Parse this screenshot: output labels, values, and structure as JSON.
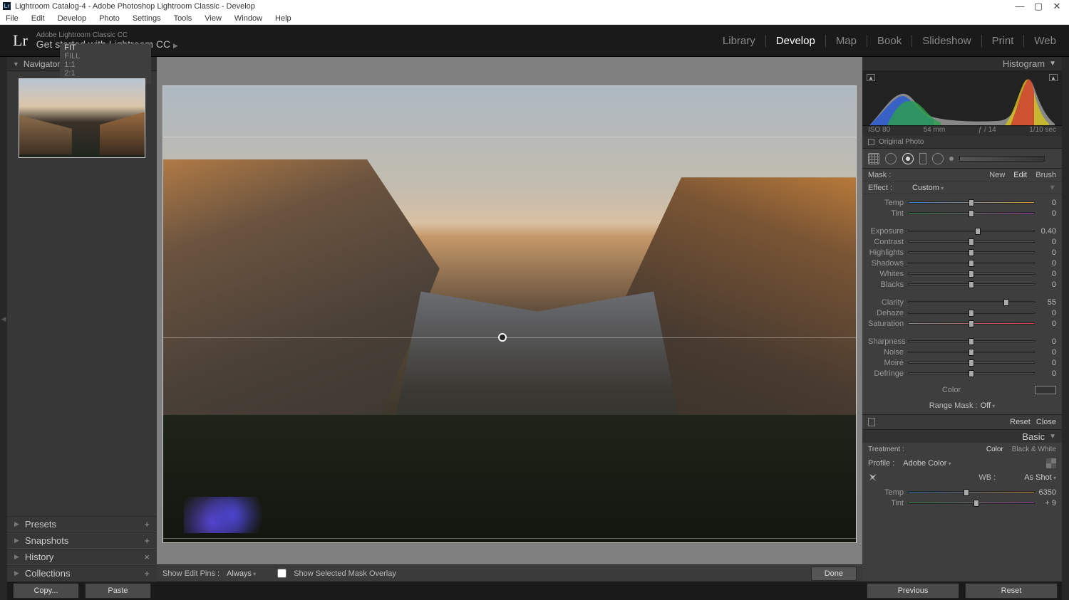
{
  "window": {
    "title": "Lightroom Catalog-4 - Adobe Photoshop Lightroom Classic - Develop"
  },
  "menu": [
    "File",
    "Edit",
    "Develop",
    "Photo",
    "Settings",
    "Tools",
    "View",
    "Window",
    "Help"
  ],
  "identity": {
    "brand_small": "Adobe Lightroom Classic CC",
    "brand_big": "Get started with Lightroom CC"
  },
  "modules": [
    "Library",
    "Develop",
    "Map",
    "Book",
    "Slideshow",
    "Print",
    "Web"
  ],
  "active_module": "Develop",
  "left": {
    "navigator": {
      "label": "Navigator",
      "zoom": [
        "FIT",
        "FILL",
        "1:1",
        "2:1"
      ]
    },
    "panels": [
      {
        "label": "Presets",
        "action": "+"
      },
      {
        "label": "Snapshots",
        "action": "+"
      },
      {
        "label": "History",
        "action": "×"
      },
      {
        "label": "Collections",
        "action": "+"
      }
    ]
  },
  "center_toolbar": {
    "show_pins": "Show Edit Pins :",
    "pins_mode": "Always",
    "overlay_label": "Show Selected Mask Overlay",
    "done": "Done"
  },
  "rightpanel": {
    "histogram_label": "Histogram",
    "exif": {
      "iso": "ISO 80",
      "focal": "54 mm",
      "aperture": "ƒ / 14",
      "shutter": "1/10 sec"
    },
    "original": "Original Photo",
    "mask": {
      "label": "Mask :",
      "new": "New",
      "edit": "Edit",
      "brush": "Brush"
    },
    "effect": {
      "label": "Effect :",
      "value": "Custom"
    },
    "group1": [
      {
        "k": "temp",
        "label": "Temp",
        "val": "0",
        "pos": 50,
        "cls": "temp"
      },
      {
        "k": "tint",
        "label": "Tint",
        "val": "0",
        "pos": 50,
        "cls": "tint"
      }
    ],
    "group2": [
      {
        "k": "exposure",
        "label": "Exposure",
        "val": "0.40",
        "pos": 55
      },
      {
        "k": "contrast",
        "label": "Contrast",
        "val": "0",
        "pos": 50
      },
      {
        "k": "highlights",
        "label": "Highlights",
        "val": "0",
        "pos": 50
      },
      {
        "k": "shadows",
        "label": "Shadows",
        "val": "0",
        "pos": 50
      },
      {
        "k": "whites",
        "label": "Whites",
        "val": "0",
        "pos": 50
      },
      {
        "k": "blacks",
        "label": "Blacks",
        "val": "0",
        "pos": 50
      }
    ],
    "group3": [
      {
        "k": "clarity",
        "label": "Clarity",
        "val": "55",
        "pos": 78
      },
      {
        "k": "dehaze",
        "label": "Dehaze",
        "val": "0",
        "pos": 50
      },
      {
        "k": "saturation",
        "label": "Saturation",
        "val": "0",
        "pos": 50,
        "cls": "sat"
      }
    ],
    "group4": [
      {
        "k": "sharpness",
        "label": "Sharpness",
        "val": "0",
        "pos": 50
      },
      {
        "k": "noise",
        "label": "Noise",
        "val": "0",
        "pos": 50
      },
      {
        "k": "moire",
        "label": "Moiré",
        "val": "0",
        "pos": 50
      },
      {
        "k": "defringe",
        "label": "Defringe",
        "val": "0",
        "pos": 50
      }
    ],
    "color_label": "Color",
    "range": {
      "label": "Range Mask :",
      "value": "Off"
    },
    "reset": "Reset",
    "close": "Close",
    "basic": {
      "head": "Basic",
      "treat": "Treatment :",
      "color": "Color",
      "bw": "Black & White",
      "profile": "Profile :",
      "profile_val": "Adobe Color",
      "wb": "WB :",
      "wb_val": "As Shot",
      "sliders": [
        {
          "k": "btemp",
          "label": "Temp",
          "val": "6350",
          "pos": 46,
          "cls": "temp"
        },
        {
          "k": "btint",
          "label": "Tint",
          "val": "+ 9",
          "pos": 54,
          "cls": "tint"
        }
      ]
    }
  },
  "footer": {
    "copy": "Copy...",
    "paste": "Paste",
    "previous": "Previous",
    "reset": "Reset"
  }
}
